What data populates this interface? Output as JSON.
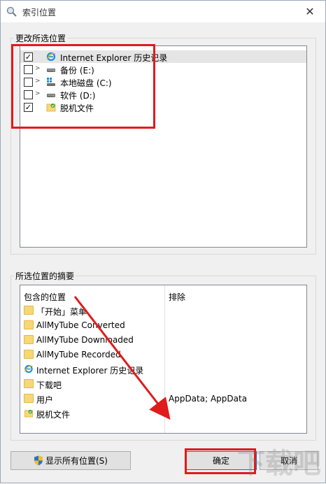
{
  "window": {
    "title": "索引位置",
    "close_glyph": "✕"
  },
  "locations_group": {
    "label": "更改所选位置",
    "items": [
      {
        "label": "Internet Explorer 历史记录",
        "checked": true,
        "expandable": false,
        "icon": "ie-icon"
      },
      {
        "label": "备份 (E:)",
        "checked": false,
        "expandable": true,
        "icon": "drive-icon"
      },
      {
        "label": "本地磁盘 (C:)",
        "checked": false,
        "expandable": true,
        "icon": "windows-drive-icon"
      },
      {
        "label": "软件 (D:)",
        "checked": false,
        "expandable": true,
        "icon": "drive-icon"
      },
      {
        "label": "脱机文件",
        "checked": true,
        "expandable": false,
        "icon": "offline-files-icon"
      }
    ]
  },
  "summary_group": {
    "label": "所选位置的摘要",
    "included_header": "包含的位置",
    "excluded_header": "排除",
    "rows": [
      {
        "label": "「开始」菜单",
        "excluded": "",
        "icon": "folder-icon"
      },
      {
        "label": "AllMyTube Converted",
        "excluded": "",
        "icon": "folder-icon"
      },
      {
        "label": "AllMyTube Downloaded",
        "excluded": "",
        "icon": "folder-icon"
      },
      {
        "label": "AllMyTube Recorded",
        "excluded": "",
        "icon": "folder-icon"
      },
      {
        "label": "Internet Explorer 历史记录",
        "excluded": "",
        "icon": "ie-icon"
      },
      {
        "label": "下载吧",
        "excluded": "",
        "icon": "folder-icon"
      },
      {
        "label": "用户",
        "excluded": "AppData; AppData",
        "icon": "folder-icon"
      },
      {
        "label": "脱机文件",
        "excluded": "",
        "icon": "offline-files-icon"
      }
    ]
  },
  "buttons": {
    "show_all": "显示所有位置(S)",
    "ok": "确定",
    "cancel": "取消"
  },
  "watermark": "下载吧",
  "colors": {
    "annotation_red": "#e01b1b",
    "folder_yellow": "#f8d775",
    "ie_blue": "#1a8fd6",
    "button_focus": "#0078d7"
  }
}
